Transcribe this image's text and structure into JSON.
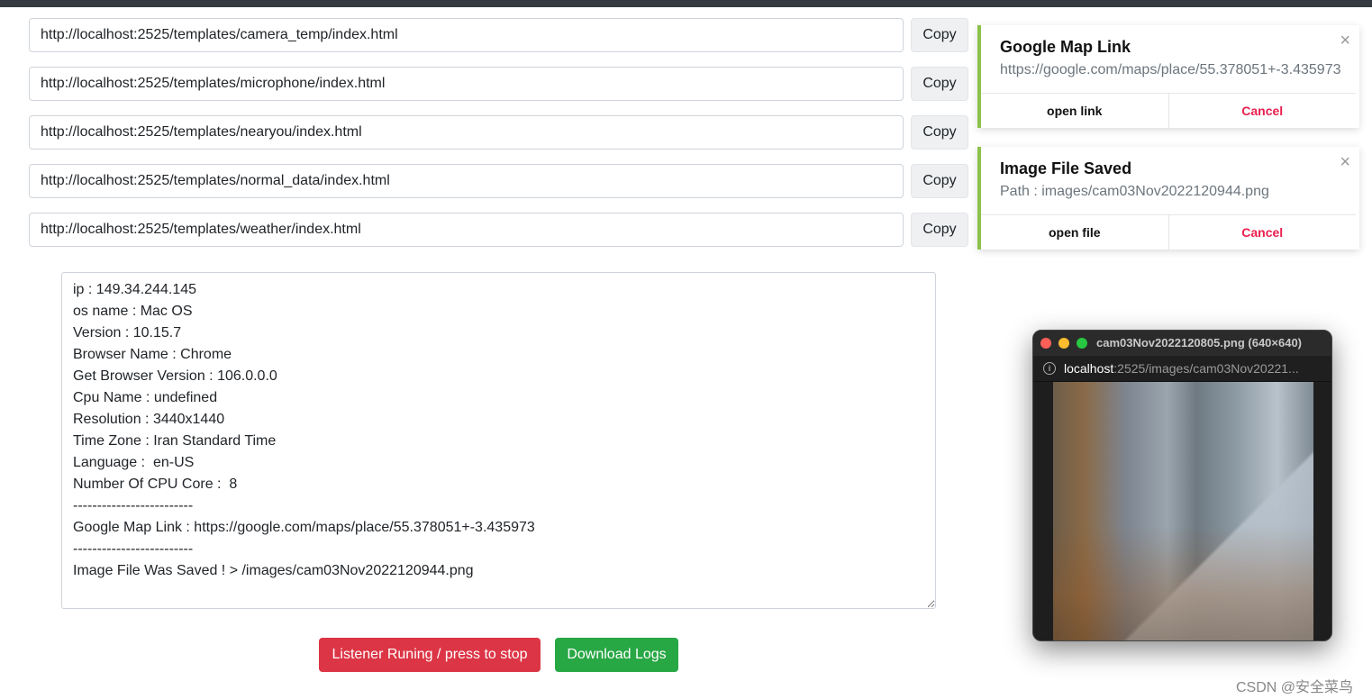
{
  "urls": [
    {
      "value": "http://localhost:2525/templates/camera_temp/index.html",
      "copy_label": "Copy"
    },
    {
      "value": "http://localhost:2525/templates/microphone/index.html",
      "copy_label": "Copy"
    },
    {
      "value": "http://localhost:2525/templates/nearyou/index.html",
      "copy_label": "Copy"
    },
    {
      "value": "http://localhost:2525/templates/normal_data/index.html",
      "copy_label": "Copy"
    },
    {
      "value": "http://localhost:2525/templates/weather/index.html",
      "copy_label": "Copy"
    }
  ],
  "log": {
    "text": "ip : 149.34.244.145\nos name : Mac OS\nVersion : 10.15.7\nBrowser Name : Chrome\nGet Browser Version : 106.0.0.0\nCpu Name : undefined\nResolution : 3440x1440\nTime Zone : Iran Standard Time\nLanguage :  en-US\nNumber Of CPU Core :  8\n-------------------------\nGoogle Map Link : https://google.com/maps/place/55.378051+-3.435973\n-------------------------\nImage File Was Saved ! > /images/cam03Nov2022120944.png"
  },
  "buttons": {
    "stop": "Listener Runing / press to stop",
    "download": "Download Logs"
  },
  "toasts": [
    {
      "title": "Google Map Link",
      "message": "https://google.com/maps/place/55.378051+-3.435973",
      "action": "open link",
      "cancel": "Cancel",
      "close": "×"
    },
    {
      "title": "Image File Saved",
      "message": "Path : images/cam03Nov2022120944.png",
      "action": "open file",
      "cancel": "Cancel",
      "close": "×"
    }
  ],
  "popup": {
    "title": "cam03Nov2022120805.png (640×640)",
    "url_host": "localhost",
    "url_rest": ":2525/images/cam03Nov20221...",
    "info_icon": "info-icon"
  },
  "colors": {
    "danger": "#dc3545",
    "success": "#28a745",
    "toast_accent": "#8bc34a",
    "cancel_text": "#e91e4e"
  },
  "watermark": "CSDN @安全菜鸟"
}
